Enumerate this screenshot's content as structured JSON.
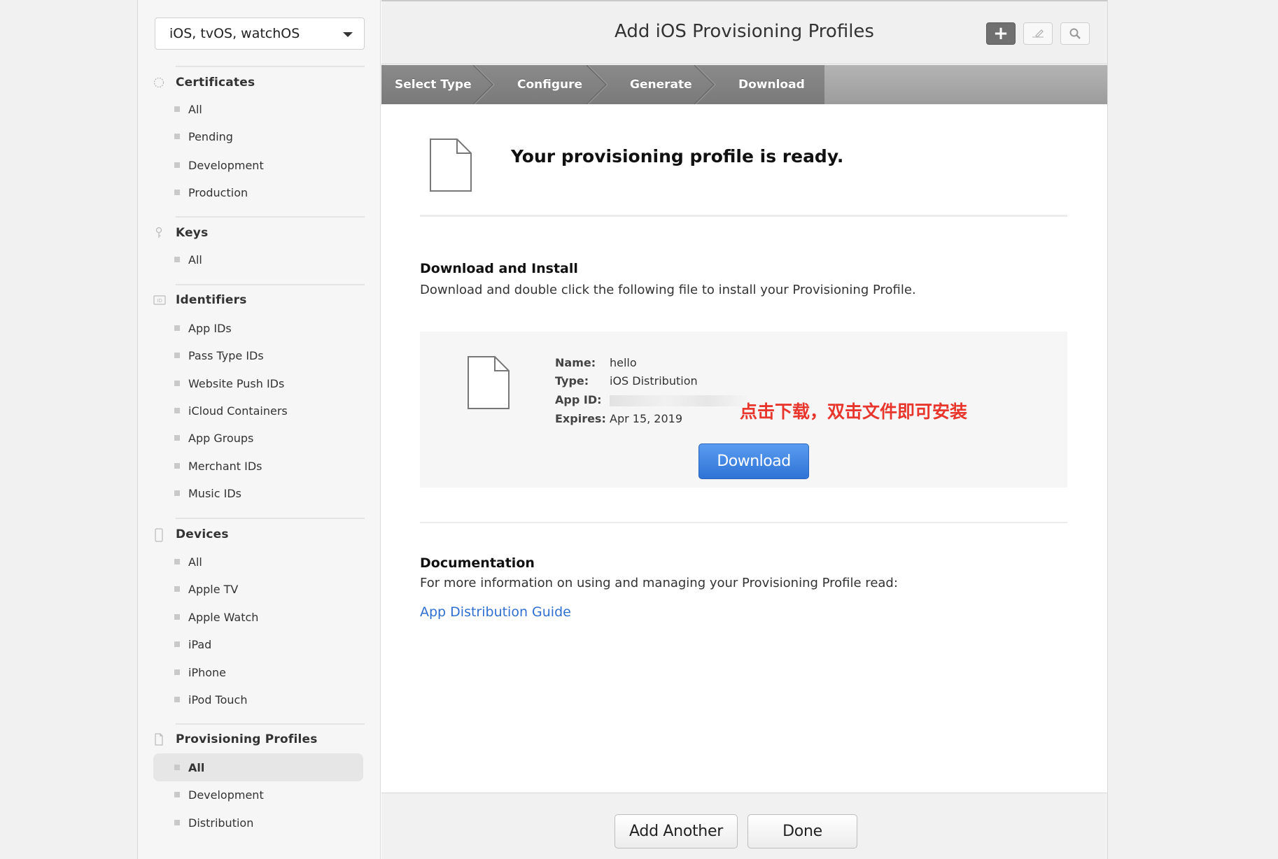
{
  "sidebar": {
    "platform": "iOS, tvOS, watchOS",
    "sections": {
      "certificates": {
        "title": "Certificates",
        "items": [
          "All",
          "Pending",
          "Development",
          "Production"
        ]
      },
      "keys": {
        "title": "Keys",
        "items": [
          "All"
        ]
      },
      "identifiers": {
        "title": "Identifiers",
        "items": [
          "App IDs",
          "Pass Type IDs",
          "Website Push IDs",
          "iCloud Containers",
          "App Groups",
          "Merchant IDs",
          "Music IDs"
        ]
      },
      "devices": {
        "title": "Devices",
        "items": [
          "All",
          "Apple TV",
          "Apple Watch",
          "iPad",
          "iPhone",
          "iPod Touch"
        ]
      },
      "profiles": {
        "title": "Provisioning Profiles",
        "items": [
          "All",
          "Development",
          "Distribution"
        ],
        "active_item": "All"
      }
    }
  },
  "header": {
    "title": "Add iOS Provisioning Profiles",
    "steps": [
      "Select Type",
      "Configure",
      "Generate",
      "Download"
    ]
  },
  "main": {
    "ready_title": "Your provisioning profile is ready.",
    "download_heading": "Download and Install",
    "download_text": "Download and double click the following file to install your Provisioning Profile.",
    "profile": {
      "name_label": "Name:",
      "name": "hello",
      "type_label": "Type:",
      "type": "iOS Distribution",
      "appid_label": "App ID:",
      "expires_label": "Expires:",
      "expires": "Apr 15, 2019"
    },
    "annotation": "点击下载，双击文件即可安装",
    "download_button": "Download",
    "doc_heading": "Documentation",
    "doc_text": "For more information on using and managing your Provisioning Profile read:",
    "doc_link": "App Distribution Guide"
  },
  "footer": {
    "add_another": "Add Another",
    "done": "Done"
  },
  "colors": {
    "accent": "#2f73d6",
    "annotation": "#e8362d",
    "link": "#2f6fd0"
  },
  "icons": [
    "plus-icon",
    "edit-icon",
    "search-icon",
    "certificate-icon",
    "key-icon",
    "id-icon",
    "device-icon",
    "document-icon",
    "caret-down-icon"
  ]
}
